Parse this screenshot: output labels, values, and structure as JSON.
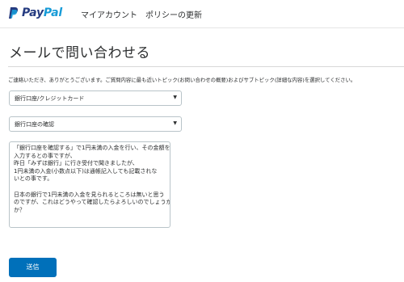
{
  "header": {
    "logo_pay": "Pay",
    "logo_pal": "Pal",
    "nav": [
      {
        "label": "マイアカウント"
      },
      {
        "label": "ポリシーの更新"
      }
    ]
  },
  "page": {
    "title": "メールで問い合わせる",
    "instruction": "ご連絡いただき、ありがとうございます。ご質問内容に最も近いトピック(お問い合わせの概要)およびサブトピック(詳細な内容)を選択してください。"
  },
  "form": {
    "topic": {
      "selected": "銀行口座/クレジットカード"
    },
    "subtopic": {
      "selected": "銀行口座の確認"
    },
    "message_lines": [
      "「銀行口座を確認する」で1円未満の入金を行い、その金額を",
      "入力するとの事ですが、",
      "昨日「みずほ銀行」に行き受付で聞きましたが、",
      "1円未満の入金(小数点以下)は通帳記入しても記載されな",
      "いとの事です。",
      "",
      "日本の銀行で1円未満の入金を見られるところは無いと思う",
      "のですが、これはどうやって確認したらよろしいのでしょうか",
      "か？"
    ],
    "submit_label": "送信"
  },
  "colors": {
    "brand_dark": "#253b80",
    "brand_light": "#179bd7",
    "button": "#0070ba"
  }
}
